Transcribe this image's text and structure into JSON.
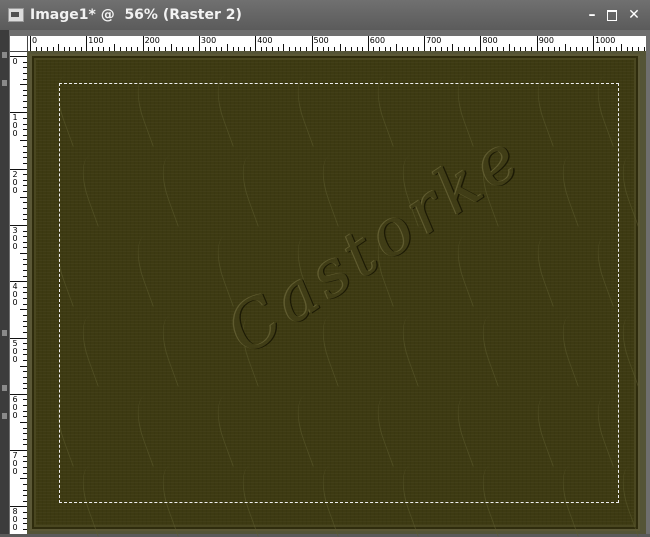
{
  "window": {
    "title": "Image1* @  56% (Raster 2)",
    "controls": {
      "minimize": "–",
      "close": "✕"
    }
  },
  "ruler": {
    "horizontal_labels": [
      "0",
      "100",
      "200",
      "300",
      "400",
      "500",
      "600",
      "700",
      "800",
      "900",
      "1000"
    ],
    "vertical_labels": [
      "0",
      "1\n0\n0",
      "2\n0\n0",
      "3\n0\n0",
      "4\n0\n0",
      "5\n0\n0",
      "6\n0\n0",
      "7\n0\n0",
      "8\n0\n0"
    ]
  },
  "canvas": {
    "watermark_text": "Castorke",
    "background_color": "#3d3a12",
    "selection_style": "marching-ants"
  },
  "colors": {
    "titlebar": "#666666",
    "title_text": "#f2f2f2",
    "ruler_bg": "#ffffff"
  }
}
